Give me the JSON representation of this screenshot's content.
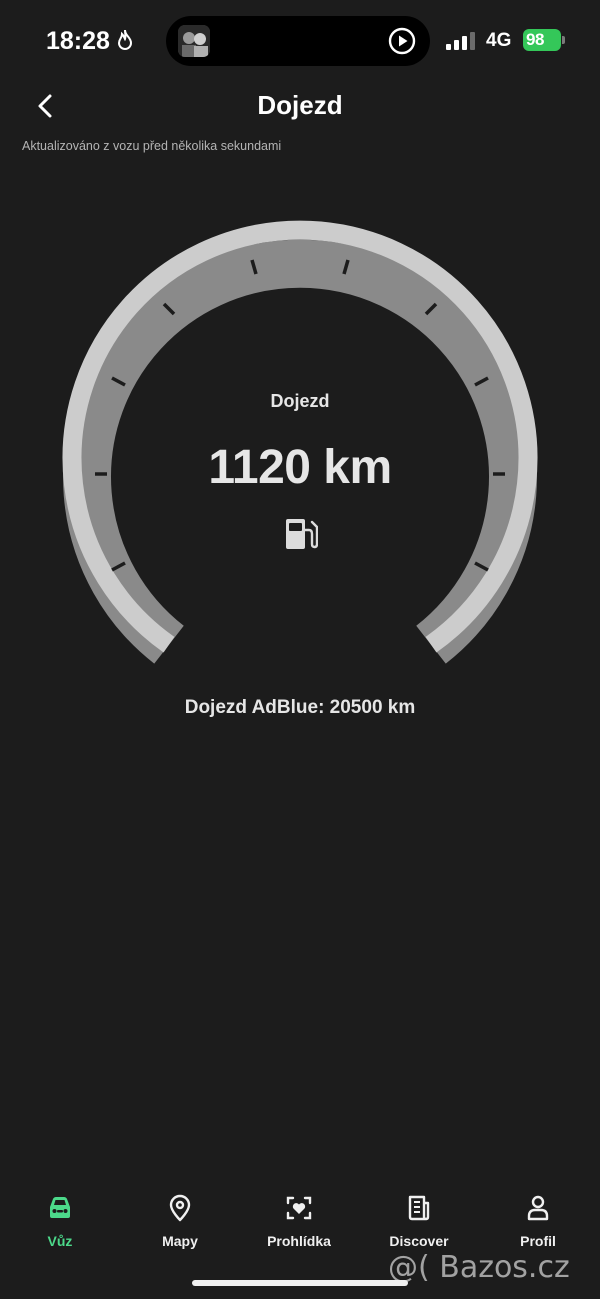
{
  "status": {
    "time": "18:28",
    "network": "4G",
    "battery": "98"
  },
  "header": {
    "title": "Dojezd",
    "updated": "Aktualizováno z vozu před několika sekundami"
  },
  "gauge": {
    "label": "Dojezd",
    "value": "1120 km",
    "fill_fraction": 1.0,
    "icon": "fuel-pump-icon"
  },
  "adblue": "Dojezd AdBlue: 20500 km",
  "tabs": [
    {
      "label": "Vůz",
      "icon": "car-icon",
      "active": true
    },
    {
      "label": "Mapy",
      "icon": "map-pin-icon",
      "active": false
    },
    {
      "label": "Prohlídka",
      "icon": "inspection-icon",
      "active": false
    },
    {
      "label": "Discover",
      "icon": "news-icon",
      "active": false
    },
    {
      "label": "Profil",
      "icon": "person-icon",
      "active": false
    }
  ],
  "watermark": "@( Bazos.cz",
  "colors": {
    "background": "#1c1c1c",
    "active_tab": "#4cd98a",
    "gauge_fill": "#cccccc",
    "gauge_track": "#8a8a8a",
    "battery": "#34c759"
  }
}
